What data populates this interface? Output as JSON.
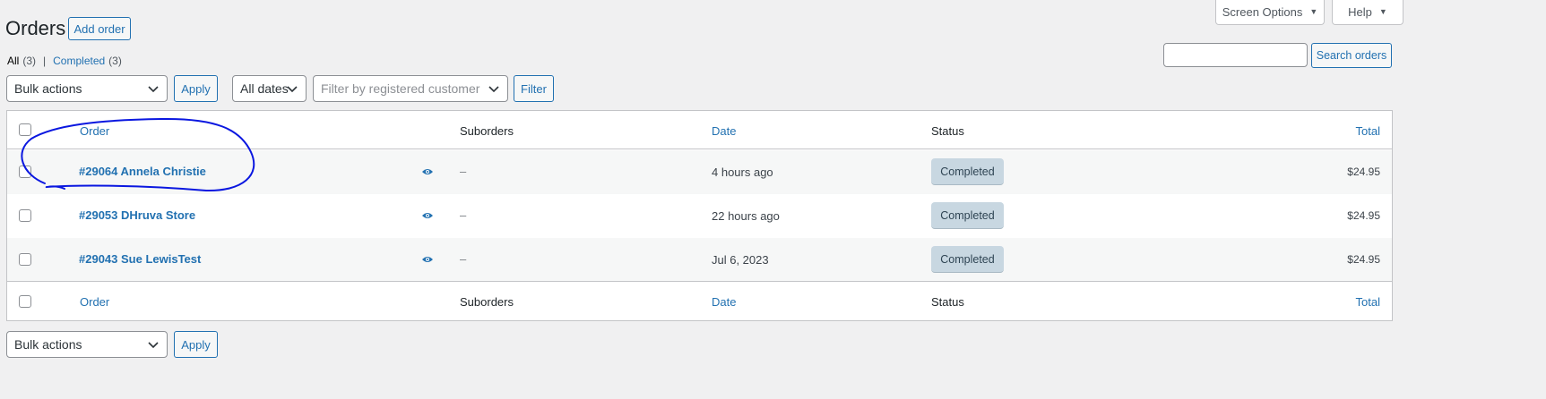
{
  "page": {
    "title": "Orders",
    "add_order_label": "Add order"
  },
  "top_buttons": {
    "screen_options": "Screen Options",
    "help": "Help"
  },
  "subsubsub": {
    "all_label": "All",
    "all_count": "(3)",
    "separator": "|",
    "completed_label": "Completed",
    "completed_count": "(3)"
  },
  "search": {
    "value": "",
    "button_label": "Search orders"
  },
  "filters": {
    "bulk_actions": "Bulk actions",
    "apply_label": "Apply",
    "dates": "All dates",
    "customer_placeholder": "Filter by registered customer",
    "filter_label": "Filter"
  },
  "table": {
    "columns": {
      "order": "Order",
      "suborders": "Suborders",
      "date": "Date",
      "status": "Status",
      "total": "Total"
    },
    "rows": [
      {
        "order": "#29064 Annela Christie",
        "suborders": "–",
        "date": "4 hours ago",
        "status": "Completed",
        "total": "$24.95"
      },
      {
        "order": "#29053 DHruva Store",
        "suborders": "–",
        "date": "22 hours ago",
        "status": "Completed",
        "total": "$24.95"
      },
      {
        "order": "#29043 Sue LewisTest",
        "suborders": "–",
        "date": "Jul 6, 2023",
        "status": "Completed",
        "total": "$24.95"
      }
    ]
  },
  "bottom_actions": {
    "bulk_actions": "Bulk actions",
    "apply_label": "Apply"
  },
  "colors": {
    "link": "#2271b1",
    "background": "#f0f0f1",
    "status_completed_bg": "#c8d7e1",
    "annotation": "#0a17e0"
  },
  "icons": {
    "preview": "eye-icon",
    "dropdown": "chevron-down-icon",
    "toggle": "caret-down-icon"
  }
}
